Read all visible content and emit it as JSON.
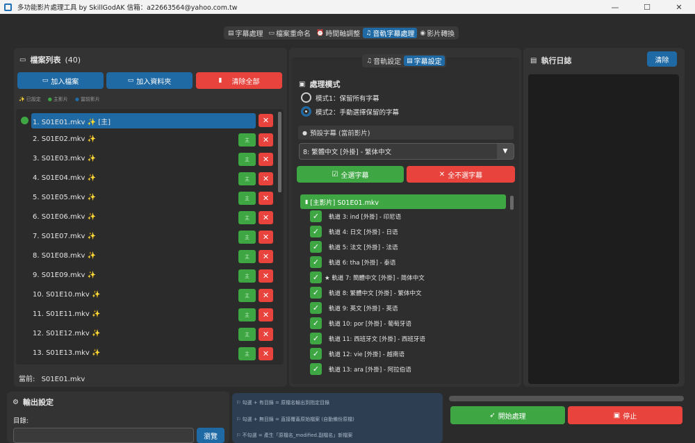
{
  "window": {
    "title": "多功能影片處理工具 by SkillGodAK  信箱：a22663564@yahoo.com.tw",
    "controls": {
      "minimize": "—",
      "maximize": "☐",
      "close": "✕"
    }
  },
  "main_tabs": [
    {
      "icon": "▤",
      "label": "字幕處理",
      "active": false
    },
    {
      "icon": "▭",
      "label": "檔案重命名",
      "active": false
    },
    {
      "icon": "⏰",
      "label": "時間軸調整",
      "active": false
    },
    {
      "icon": "♫",
      "label": "音軌字幕處理",
      "active": true
    },
    {
      "icon": "◉",
      "label": "影片轉換",
      "active": false
    }
  ],
  "file_panel": {
    "title": "檔案列表",
    "count": "(40)",
    "add_file": "加入檔案",
    "add_folder": "加入資料夾",
    "clear_all": "清除全部",
    "legend": [
      {
        "sym": "✨",
        "text": "已設定"
      },
      {
        "sym": "●",
        "text": "主影片"
      },
      {
        "sym": "●",
        "text": "當前影片"
      }
    ],
    "files": [
      {
        "name": "1. S01E01.mkv ✨ [主]",
        "selected": true
      },
      {
        "name": "2. S01E02.mkv ✨",
        "selected": false
      },
      {
        "name": "3. S01E03.mkv ✨",
        "selected": false
      },
      {
        "name": "4. S01E04.mkv ✨",
        "selected": false
      },
      {
        "name": "5. S01E05.mkv ✨",
        "selected": false
      },
      {
        "name": "6. S01E06.mkv ✨",
        "selected": false
      },
      {
        "name": "7. S01E07.mkv ✨",
        "selected": false
      },
      {
        "name": "8. S01E08.mkv ✨",
        "selected": false
      },
      {
        "name": "9. S01E09.mkv ✨",
        "selected": false
      },
      {
        "name": "10. S01E10.mkv ✨",
        "selected": false
      },
      {
        "name": "11. S01E11.mkv ✨",
        "selected": false
      },
      {
        "name": "12. S01E12.mkv ✨",
        "selected": false
      },
      {
        "name": "13. S01E13.mkv ✨",
        "selected": false
      }
    ],
    "set_label": "主",
    "delete_label": "✕",
    "current_label": "當前:",
    "current_value": "S01E01.mkv"
  },
  "sub_tabs": [
    {
      "icon": "♫",
      "label": "音軌設定",
      "active": false
    },
    {
      "icon": "▤",
      "label": "字幕設定",
      "active": true
    }
  ],
  "subtitle_settings": {
    "mode_title": "處理模式",
    "mode1": "模式1：保留所有字幕",
    "mode2": "模式2：手動選擇保留的字幕",
    "selected_mode": 2,
    "default_label": "預設字幕 (當前影片)",
    "default_value": "8: 繁體中文 [外掛] - 繁体中文",
    "select_all": "全選字幕",
    "deselect_all": "全不選字幕",
    "group_header": "[主影片] S01E01.mkv",
    "tracks": [
      "軌道 3: ind [外掛] - 印尼语",
      "軌道 4: 日文 [外掛] - 日语",
      "軌道 5: 法文 [外掛] - 法语",
      "軌道 6: tha [外掛] - 泰语",
      "★ 軌道 7: 簡體中文 [外掛] - 简体中文",
      "軌道 8: 繁體中文 [外掛] - 繁体中文",
      "軌道 9: 英文 [外掛] - 英语",
      "軌道 10: por [外掛] - 葡萄牙语",
      "軌道 11: 西班牙文 [外掛] - 西班牙语",
      "軌道 12: vie [外掛] - 越南语",
      "軌道 13: ara [外掛] - 阿拉伯语"
    ]
  },
  "log_panel": {
    "title": "執行日誌",
    "clear": "清除"
  },
  "output_panel": {
    "title": "輸出設定",
    "dir_label": "目錄:",
    "browse": "瀏覽"
  },
  "info_lines": [
    "⚐ 勾選 + 有目錄 = 原檔名輸出到指定目錄",
    "⚐ 勾選 + 無目錄 = 直接覆蓋原始檔案 (自動備份原檔)",
    "⚐ 不勾選 = 產生「原檔名_modified.副檔名」新檔案"
  ],
  "actions": {
    "start": "開始處理",
    "stop": "停止",
    "progress": 0
  },
  "colors": {
    "accent_blue": "#1f6aa5",
    "green": "#3ea743",
    "red": "#e8433c",
    "background": "#2b2b2b"
  }
}
